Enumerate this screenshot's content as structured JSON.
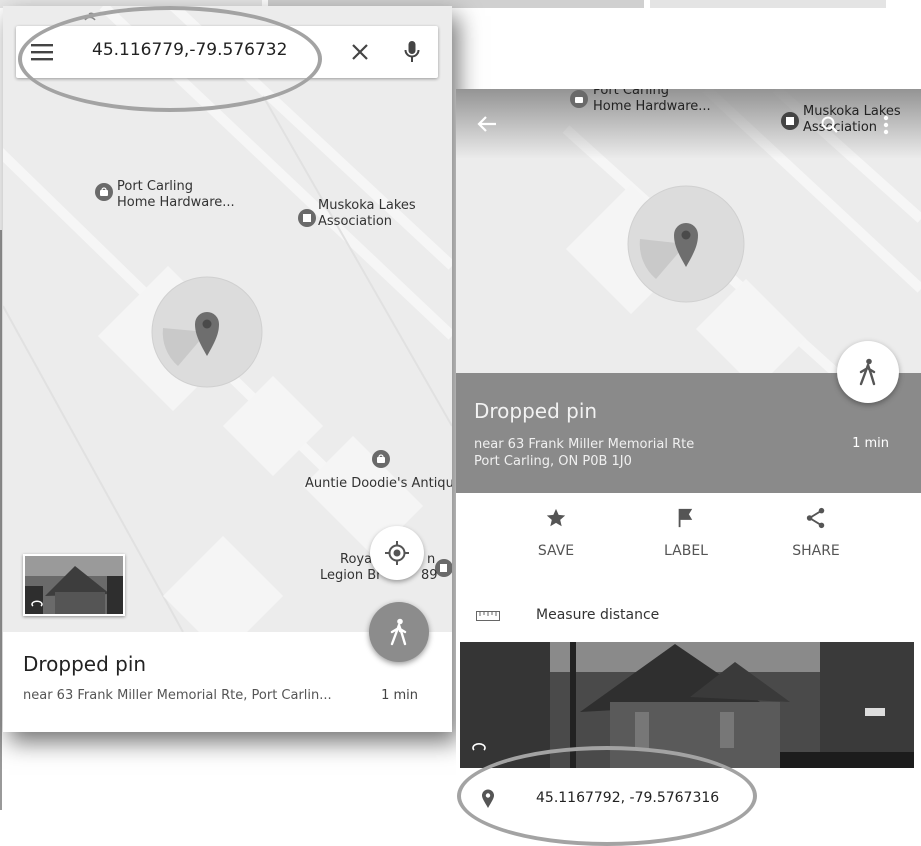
{
  "left": {
    "search": {
      "query": "45.116779,-79.576732"
    },
    "map_labels": {
      "hardware": "Port Carling\nHome Hardware...",
      "muskoka": "Muskoka Lakes\nAssociation",
      "antiques": "Auntie Doodie's Antique",
      "legion_line1": "Roya",
      "legion_line1b": "n",
      "legion_line2": "Legion Br",
      "legion_line2b": "89"
    },
    "info": {
      "title": "Dropped pin",
      "address": "near 63 Frank Miller Memorial Rte, Port Carlin...",
      "walk_time": "1 min"
    }
  },
  "right": {
    "map_labels": {
      "hardware": "Port Carling\nHome Hardware...",
      "muskoka_line1": "Muskoka Lakes",
      "muskoka_line2": "Association"
    },
    "info": {
      "title": "Dropped pin",
      "address_line1": "near 63 Frank Miller Memorial Rte",
      "address_line2": "Port Carling, ON P0B 1J0",
      "walk_time": "1 min"
    },
    "actions": [
      {
        "label": "SAVE",
        "icon": "star-icon"
      },
      {
        "label": "LABEL",
        "icon": "flag-icon"
      },
      {
        "label": "SHARE",
        "icon": "share-icon"
      }
    ],
    "measure_label": "Measure distance",
    "coordinates": "45.1167792, -79.5767316"
  },
  "colors": {
    "map_bg": "#ececec",
    "info_bar": "#8a8a8a",
    "fab_gray": "#8c8c8c",
    "highlight": "#a3a3a3"
  }
}
